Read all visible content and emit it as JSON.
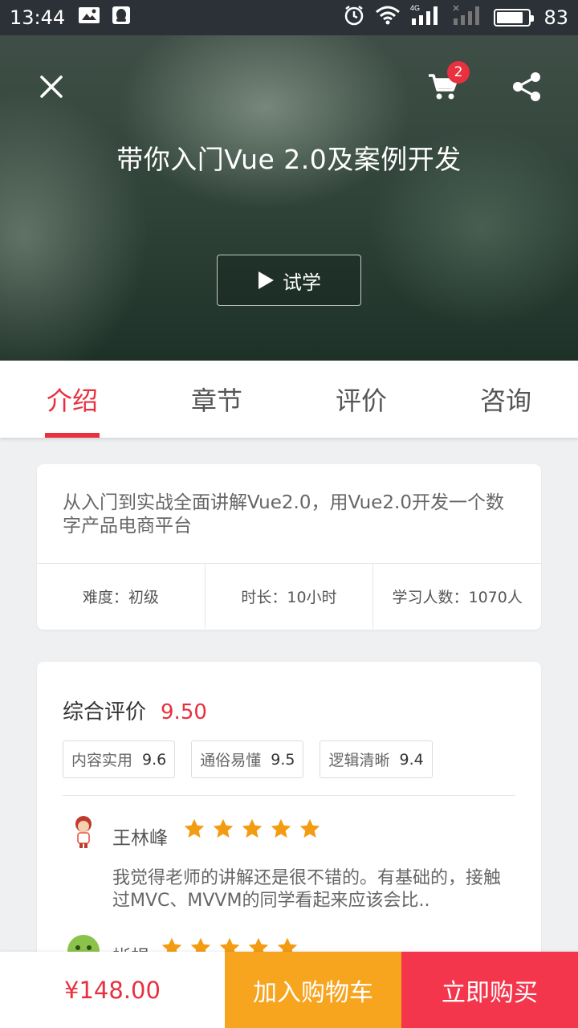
{
  "status_bar": {
    "time": "13:44",
    "battery_level": "83",
    "battery_fraction": 0.83,
    "network": "4G",
    "icons": [
      "image-icon",
      "qq-icon",
      "alarm-icon",
      "wifi-icon",
      "signal-icon",
      "signal-weak-icon",
      "battery-icon"
    ]
  },
  "header": {
    "cart_count": "2",
    "course_title": "带你入门Vue 2.0及案例开发",
    "trial_label": "试学",
    "icons": [
      "close-icon",
      "cart-icon",
      "share-icon",
      "play-icon"
    ]
  },
  "tabs": [
    {
      "label": "介绍",
      "active": true
    },
    {
      "label": "章节",
      "active": false
    },
    {
      "label": "评价",
      "active": false
    },
    {
      "label": "咨询",
      "active": false
    }
  ],
  "intro": {
    "description": "从入门到实战全面讲解Vue2.0，用Vue2.0开发一个数字产品电商平台",
    "difficulty": "难度：初级",
    "duration": "时长：10小时",
    "learners": "学习人数：1070人"
  },
  "rating": {
    "label": "综合评价",
    "score": "9.50",
    "tags": [
      {
        "label": "内容实用",
        "score": "9.6"
      },
      {
        "label": "通俗易懂",
        "score": "9.5"
      },
      {
        "label": "逻辑清晰",
        "score": "9.4"
      }
    ]
  },
  "reviews": [
    {
      "name": "王林峰",
      "stars": 5,
      "text": "我觉得老师的讲解还是很不错的。有基础的，接触过MVC、MVVM的同学看起来应该会比.."
    },
    {
      "name": "蜥蜴",
      "stars": 5,
      "text": ""
    }
  ],
  "bottom_bar": {
    "price": "¥148.00",
    "add_to_cart": "加入购物车",
    "buy_now": "立即购买"
  },
  "colors": {
    "accent": "#e8303f",
    "add_to_cart_bg": "#f7a41f",
    "buy_now_bg": "#f4364c",
    "star": "#f39c12"
  }
}
